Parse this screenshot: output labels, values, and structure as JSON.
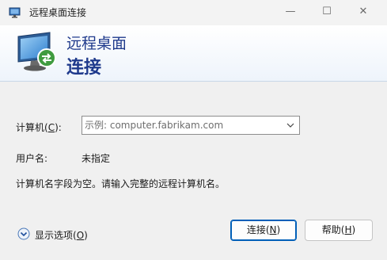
{
  "window": {
    "title": "远程桌面连接",
    "controls": {
      "minimize": "—",
      "maximize": "☐",
      "close": "✕"
    }
  },
  "banner": {
    "line1": "远程桌面",
    "line2": "连接"
  },
  "form": {
    "computer_label_pre": "计算机(",
    "computer_label_key": "C",
    "computer_label_post": "):",
    "computer_value": "",
    "computer_placeholder": "示例: computer.fabrikam.com",
    "username_label": "用户名:",
    "username_value": "未指定",
    "message": "计算机名字段为空。请输入完整的远程计算机名。"
  },
  "footer": {
    "options_pre": "显示选项(",
    "options_key": "O",
    "options_post": ")",
    "connect_pre": "连接(",
    "connect_key": "N",
    "connect_post": ")",
    "help_pre": "帮助(",
    "help_key": "H",
    "help_post": ")"
  },
  "colors": {
    "accent": "#005fb8",
    "banner_text": "#1f3a8c"
  },
  "icons": {
    "app": "remote-desktop-icon",
    "banner": "remote-desktop-monitor-icon",
    "dropdown": "chevron-down-icon",
    "options": "expand-circle-icon"
  }
}
